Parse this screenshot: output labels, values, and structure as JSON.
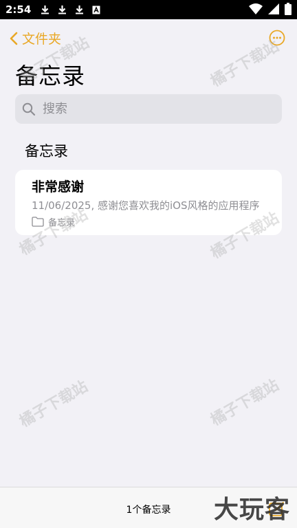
{
  "status_bar": {
    "time": "2:54",
    "left_icons": [
      "download-icon",
      "download-icon",
      "download-icon",
      "font-icon"
    ],
    "right_icons": [
      "wifi-icon",
      "signal-icon",
      "battery-icon"
    ]
  },
  "nav": {
    "back_label": "文件夹",
    "accent_color": "#e9a826",
    "more_icon": "more-circle-icon"
  },
  "page": {
    "title": "备忘录"
  },
  "search": {
    "placeholder": "搜索",
    "icon": "search-icon"
  },
  "section": {
    "header": "备忘录"
  },
  "notes": [
    {
      "title": "非常感谢",
      "snippet": "11/06/2025, 感谢您喜欢我的iOS风格的应用程序",
      "folder": "备忘录",
      "folder_icon": "folder-icon"
    }
  ],
  "bottom_bar": {
    "count_label": "1个备忘录",
    "compose_icon": "compose-icon"
  },
  "watermarks": [
    "橘子下载站",
    "橘子下载站",
    "橘子下载站",
    "橘子下载站",
    "橘子下载站",
    "橘子下载站"
  ],
  "brand": "大玩客"
}
